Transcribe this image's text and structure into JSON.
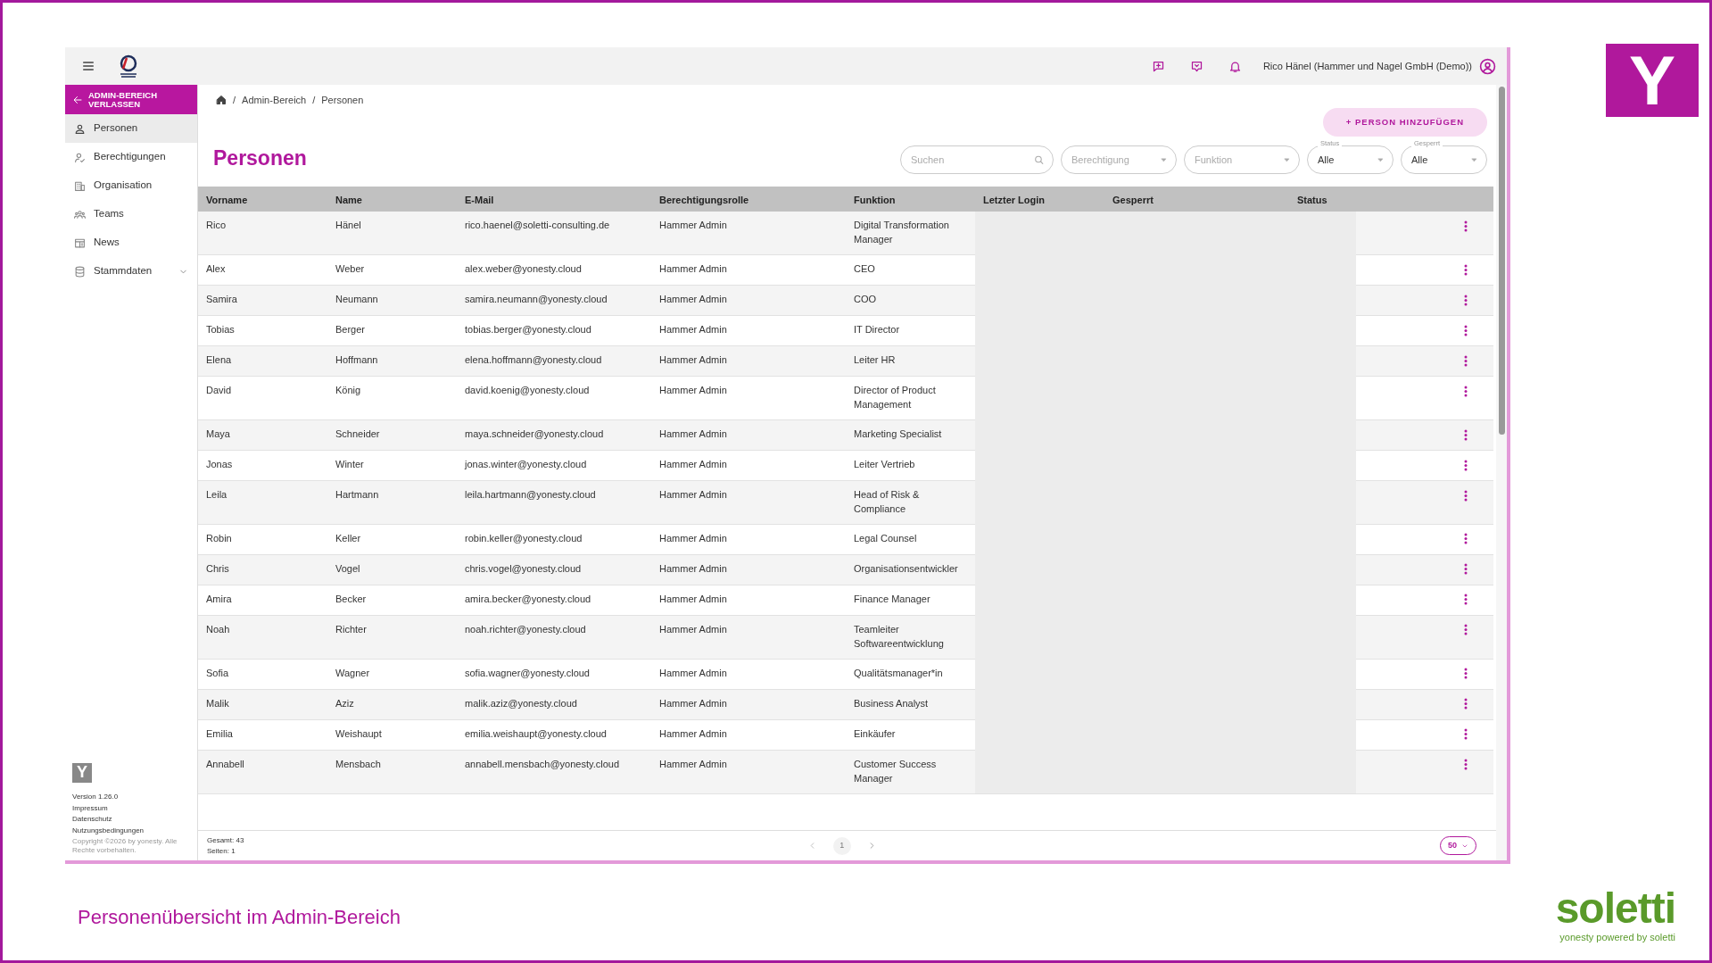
{
  "slide": {
    "title": "Personenübersicht im Admin-Bereich",
    "corner_logo": "Y",
    "brand": "soletti",
    "brand_tagline": "yonesty powered by soletti"
  },
  "topbar": {
    "user_label": "Rico Hänel (Hammer und Nagel GmbH (Demo))"
  },
  "sidebar": {
    "back_button": "ADMIN-BEREICH VERLASSEN",
    "items": [
      {
        "label": "Personen",
        "selected": true
      },
      {
        "label": "Berechtigungen",
        "selected": false
      },
      {
        "label": "Organisation",
        "selected": false
      },
      {
        "label": "Teams",
        "selected": false
      },
      {
        "label": "News",
        "selected": false
      },
      {
        "label": "Stammdaten",
        "selected": false,
        "expanded": false
      }
    ],
    "logo": "Y",
    "version": "Version 1.26.0",
    "links": [
      "Impressum",
      "Datenschutz",
      "Nutzungsbedingungen"
    ],
    "copyright": "Copyright ©2026 by yonesty. Alle Rechte vorbehalten."
  },
  "breadcrumb": [
    "Admin-Bereich",
    "Personen"
  ],
  "breadcrumb_separator": "/",
  "page_title": "Personen",
  "add_button": "+ PERSON HINZUFÜGEN",
  "filters": [
    {
      "kind": "search",
      "placeholder": "Suchen"
    },
    {
      "kind": "select",
      "placeholder": "Berechtigung"
    },
    {
      "kind": "select",
      "placeholder": "Funktion"
    },
    {
      "kind": "select",
      "label": "Status",
      "value": "Alle"
    },
    {
      "kind": "select",
      "label": "Gesperrt",
      "value": "Alle"
    }
  ],
  "table": {
    "columns": [
      "Vorname",
      "Name",
      "E-Mail",
      "Berechtigungsrolle",
      "Funktion",
      "Letzter Login",
      "Gesperrt",
      "Status"
    ],
    "rows": [
      [
        "Rico",
        "Hänel",
        "rico.haenel@soletti-consulting.de",
        "Hammer Admin",
        "Digital Transformation Manager"
      ],
      [
        "Alex",
        "Weber",
        "alex.weber@yonesty.cloud",
        "Hammer Admin",
        "CEO"
      ],
      [
        "Samira",
        "Neumann",
        "samira.neumann@yonesty.cloud",
        "Hammer Admin",
        "COO"
      ],
      [
        "Tobias",
        "Berger",
        "tobias.berger@yonesty.cloud",
        "Hammer Admin",
        "IT Director"
      ],
      [
        "Elena",
        "Hoffmann",
        "elena.hoffmann@yonesty.cloud",
        "Hammer Admin",
        "Leiter HR"
      ],
      [
        "David",
        "König",
        "david.koenig@yonesty.cloud",
        "Hammer Admin",
        "Director of Product Management"
      ],
      [
        "Maya",
        "Schneider",
        "maya.schneider@yonesty.cloud",
        "Hammer Admin",
        "Marketing Specialist"
      ],
      [
        "Jonas",
        "Winter",
        "jonas.winter@yonesty.cloud",
        "Hammer Admin",
        "Leiter Vertrieb"
      ],
      [
        "Leila",
        "Hartmann",
        "leila.hartmann@yonesty.cloud",
        "Hammer Admin",
        "Head of Risk & Compliance"
      ],
      [
        "Robin",
        "Keller",
        "robin.keller@yonesty.cloud",
        "Hammer Admin",
        "Legal Counsel"
      ],
      [
        "Chris",
        "Vogel",
        "chris.vogel@yonesty.cloud",
        "Hammer Admin",
        "Organisationsentwickler"
      ],
      [
        "Amira",
        "Becker",
        "amira.becker@yonesty.cloud",
        "Hammer Admin",
        "Finance Manager"
      ],
      [
        "Noah",
        "Richter",
        "noah.richter@yonesty.cloud",
        "Hammer Admin",
        "Teamleiter Softwareentwicklung"
      ],
      [
        "Sofia",
        "Wagner",
        "sofia.wagner@yonesty.cloud",
        "Hammer Admin",
        "Qualitätsmanager*in"
      ],
      [
        "Malik",
        "Aziz",
        "malik.aziz@yonesty.cloud",
        "Hammer Admin",
        "Business Analyst"
      ],
      [
        "Emilia",
        "Weishaupt",
        "emilia.weishaupt@yonesty.cloud",
        "Hammer Admin",
        "Einkäufer"
      ],
      [
        "Annabell",
        "Mensbach",
        "annabell.mensbach@yonesty.cloud",
        "Hammer Admin",
        "Customer Success Manager"
      ]
    ]
  },
  "footer": {
    "total": "Gesamt: 43",
    "pages": "Seiten: 1",
    "page": "1",
    "page_size": "50"
  }
}
